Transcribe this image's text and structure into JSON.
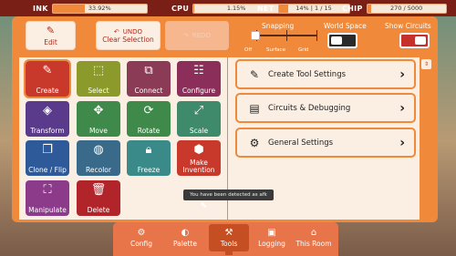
{
  "stats": {
    "ink": {
      "label": "INK",
      "value": "33.92%",
      "fill": 0.3392
    },
    "cpu": {
      "label": "CPU",
      "value": "1.15%",
      "fill": 0.0115
    },
    "net": {
      "label": "NET",
      "value": "14% | 1 / 15",
      "fill": 0.14
    },
    "chip": {
      "label": "CHIP",
      "value": "270 / 5000",
      "fill": 0.054
    }
  },
  "toolbar": {
    "edit_label": "Edit",
    "undo_label": "UNDO",
    "clear_selection_label": "Clear Selection",
    "redo_label": "REDO",
    "snapping": {
      "label": "Snapping",
      "options": [
        "Off",
        "Surface",
        "Grid"
      ],
      "selected": "Off"
    },
    "world_space": {
      "label": "World Space",
      "on": false
    },
    "show_circuits": {
      "label": "Show Circuits",
      "on": true
    }
  },
  "tools": [
    {
      "label": "Create",
      "color": "#c8392c",
      "icon": "pencil-icon",
      "selected": true
    },
    {
      "label": "Select",
      "color": "#8c9a2c",
      "icon": "select-box-icon"
    },
    {
      "label": "Connect",
      "color": "#8b3b55",
      "icon": "connect-icon"
    },
    {
      "label": "Configure",
      "color": "#8b2f5a",
      "icon": "sliders-icon"
    },
    {
      "label": "Transform",
      "color": "#5a3a8a",
      "icon": "transform-icon"
    },
    {
      "label": "Move",
      "color": "#3f8a4a",
      "icon": "move-icon"
    },
    {
      "label": "Rotate",
      "color": "#3f8a4a",
      "icon": "rotate-icon"
    },
    {
      "label": "Scale",
      "color": "#3f8a6a",
      "icon": "scale-icon"
    },
    {
      "label": "Clone / Flip",
      "color": "#2f5a9a",
      "icon": "clone-icon"
    },
    {
      "label": "Recolor",
      "color": "#3a6a8a",
      "icon": "recolor-icon"
    },
    {
      "label": "Freeze",
      "color": "#3a8a8a",
      "icon": "lock-icon"
    },
    {
      "label": "Make Invention",
      "color": "#c8392c",
      "icon": "invention-icon"
    },
    {
      "label": "Manipulate",
      "color": "#8b3b8a",
      "icon": "manipulate-icon"
    },
    {
      "label": "Delete",
      "color": "#b0242a",
      "icon": "trash-icon"
    }
  ],
  "menu": [
    {
      "label": "Create Tool Settings",
      "icon": "pencil-icon"
    },
    {
      "label": "Circuits & Debugging",
      "icon": "chip-icon"
    },
    {
      "label": "General Settings",
      "icon": "gear-icon"
    }
  ],
  "tooltip": "You have been detected as afk",
  "tabs": [
    {
      "label": "Config",
      "icon": "config-icon"
    },
    {
      "label": "Palette",
      "icon": "palette-icon"
    },
    {
      "label": "Tools",
      "icon": "tools-icon",
      "active": true
    },
    {
      "label": "Logging",
      "icon": "logging-icon"
    },
    {
      "label": "This Room",
      "icon": "home-icon"
    }
  ]
}
